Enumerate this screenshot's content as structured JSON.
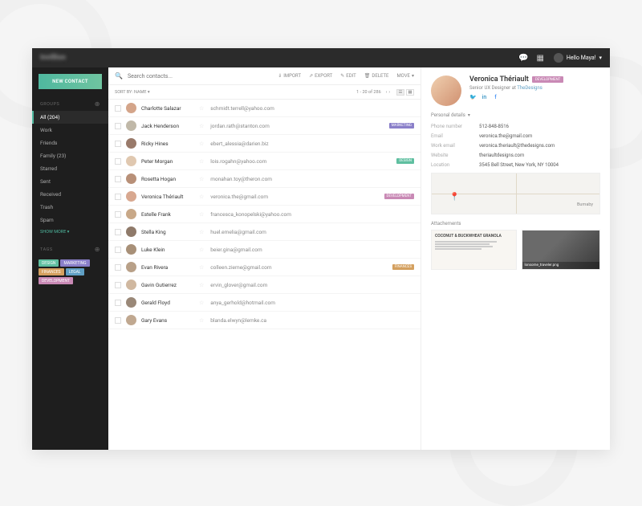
{
  "topbar": {
    "greeting": "Hello Maya!"
  },
  "sidebar": {
    "new_contact": "NEW CONTACT",
    "groups_header": "GROUPS",
    "items": [
      {
        "label": "All (204)",
        "active": true
      },
      {
        "label": "Work"
      },
      {
        "label": "Friends"
      },
      {
        "label": "Family (23)"
      },
      {
        "label": "Starred"
      },
      {
        "label": "Sent"
      },
      {
        "label": "Received"
      },
      {
        "label": "Trash"
      },
      {
        "label": "Spam"
      }
    ],
    "show_more": "SHOW MORE ▾",
    "tags_header": "TAGS",
    "tags": [
      {
        "label": "DESIGN",
        "cls": "design"
      },
      {
        "label": "MARKETING",
        "cls": "marketing"
      },
      {
        "label": "FINANCES",
        "cls": "finances"
      },
      {
        "label": "LEGAL",
        "cls": "legal"
      },
      {
        "label": "DEVELOPMENT",
        "cls": "development"
      }
    ]
  },
  "search": {
    "placeholder": "Search contacts..."
  },
  "actions": {
    "import": "IMPORT",
    "export": "EXPORT",
    "edit": "EDIT",
    "delete": "DELETE",
    "move": "MOVE"
  },
  "sort": {
    "label": "SORT BY: NAME ▾",
    "range": "1 - 20 of 286"
  },
  "contacts": [
    {
      "name": "Charlotte Salazar",
      "email": "schmidt.terrell@yahoo.com",
      "avatar": "#d4a58a"
    },
    {
      "name": "Jack Henderson",
      "email": "jordan.rath@stanton.com",
      "avatar": "#c0b8a8",
      "tag": "MARKETING",
      "tagcls": "marketing"
    },
    {
      "name": "Ricky Hines",
      "email": "ebert_alessia@darien.biz",
      "avatar": "#997a6a"
    },
    {
      "name": "Peter Morgan",
      "email": "lois.rogahn@yahoo.com",
      "avatar": "#e0c8b0",
      "tag": "DESIGN",
      "tagcls": "design"
    },
    {
      "name": "Rosetta Hogan",
      "email": "monahan.toy@theron.com",
      "avatar": "#b89078"
    },
    {
      "name": "Veronica Thériault",
      "email": "veronica.the@gmail.com",
      "avatar": "#d8a890",
      "tag": "DEVELOPMENT",
      "tagcls": "development"
    },
    {
      "name": "Estelle Frank",
      "email": "francesca_konopelski@yahoo.com",
      "avatar": "#c8a888"
    },
    {
      "name": "Stella King",
      "email": "huel.emelia@gmail.com",
      "avatar": "#8f7a6a"
    },
    {
      "name": "Luke Klein",
      "email": "beier.gina@gmail.com",
      "avatar": "#a89078"
    },
    {
      "name": "Evan Rivera",
      "email": "colleen.zieme@gmail.com",
      "avatar": "#b8a088",
      "tag": "FINANCES",
      "tagcls": "finances"
    },
    {
      "name": "Gavin Gutierrez",
      "email": "ervin_glover@gmail.com",
      "avatar": "#d0b8a0"
    },
    {
      "name": "Gerald Floyd",
      "email": "anya_gerhold@hotmail.com",
      "avatar": "#9a8878"
    },
    {
      "name": "Gary Evans",
      "email": "blanda.elwyn@lemke.ca",
      "avatar": "#c0a890"
    }
  ],
  "detail": {
    "name": "Veronica Thériault",
    "tag": "DEVELOPMENT",
    "title": "Senior UX Designer",
    "at_label": "at",
    "company": "TheDesigns",
    "sections": {
      "personal": "Personal details",
      "attachments": "Attachements"
    },
    "fields": [
      {
        "k": "Phone number",
        "v": "512-848-8516"
      },
      {
        "k": "Email",
        "v": "veronica.the@gmail.com"
      },
      {
        "k": "Work email",
        "v": "veronica.theriault@thedesigns.com"
      },
      {
        "k": "Website",
        "v": "theriaultdesigns.com"
      },
      {
        "k": "Location",
        "v": "3545 Bell Street, New York, NY 10004"
      }
    ],
    "map_label": "Burnaby",
    "attachments": [
      {
        "title": "COCONUT & BUCKWHEAT GRANOLA"
      },
      {
        "caption": "lonsome_traveler.png"
      }
    ]
  }
}
